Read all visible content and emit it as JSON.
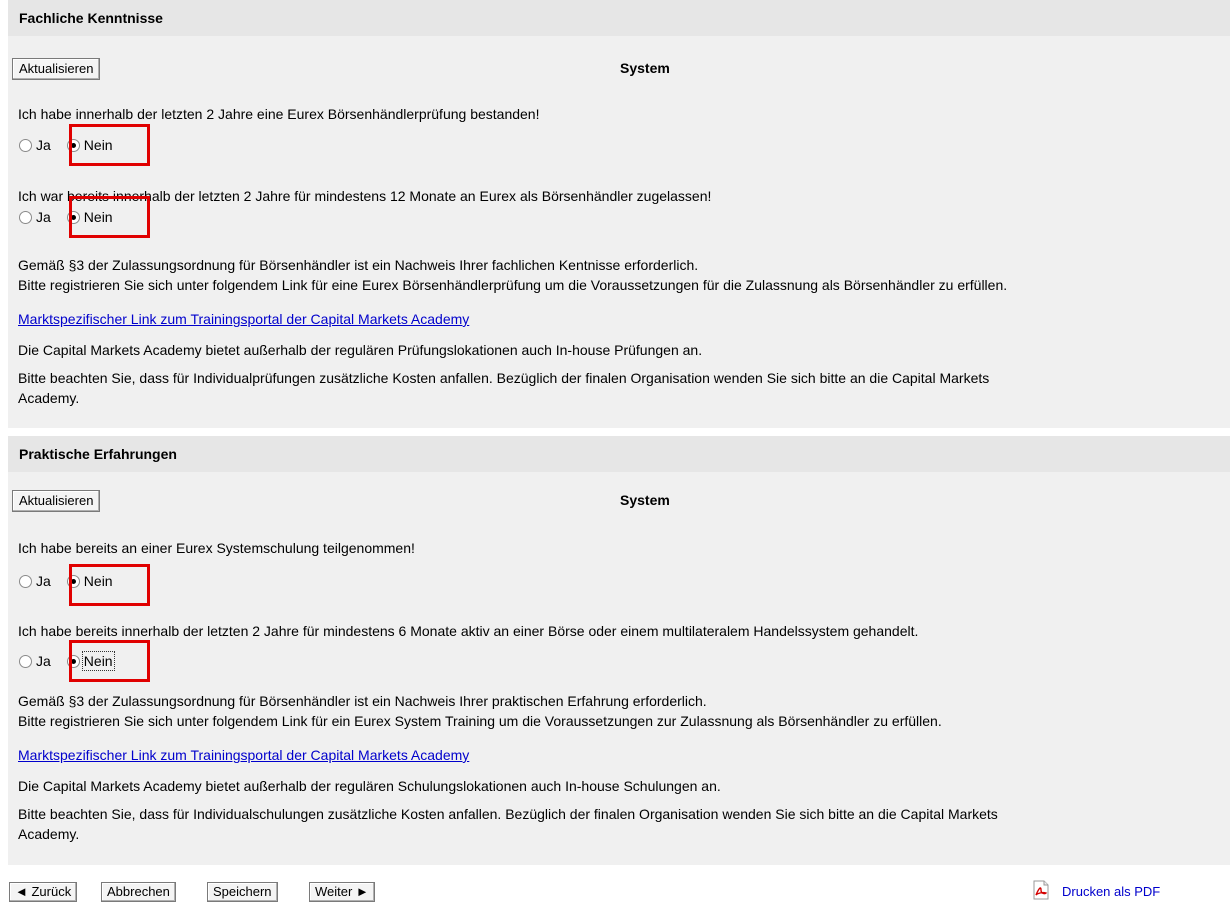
{
  "section1": {
    "title": "Fachliche Kenntnisse",
    "update_button": "Aktualisieren",
    "system_label": "System",
    "q1": {
      "text": "Ich habe innerhalb der letzten 2 Jahre eine Eurex Börsenhändlerprüfung bestanden!",
      "yes": "Ja",
      "no": "Nein",
      "selected": "Nein"
    },
    "q2": {
      "text": "Ich war bereits innerhalb der letzten 2 Jahre für mindestens 12 Monate an Eurex als Börsenhändler zugelassen!",
      "yes": "Ja",
      "no": "Nein",
      "selected": "Nein"
    },
    "info_line1": "Gemäß §3 der Zulassungsordnung für Börsenhändler ist ein Nachweis Ihrer fachlichen Kentnisse erforderlich.",
    "info_line2": "Bitte registrieren Sie sich unter folgendem Link für eine Eurex Börsenhändlerprüfung um die Voraussetzungen für die Zulassnung als Börsenhändler zu erfüllen.",
    "link": "Marktspezifischer Link zum Trainingsportal der Capital Markets Academy",
    "note1": "Die Capital Markets Academy bietet außerhalb der regulären Prüfungslokationen auch In-house Prüfungen an.",
    "note2_line1": "Bitte beachten Sie, dass für Individualprüfungen zusätzliche Kosten anfallen. Bezüglich der finalen Organisation wenden Sie sich bitte an die Capital Markets",
    "note2_line2": "Academy."
  },
  "section2": {
    "title": "Praktische Erfahrungen",
    "update_button": "Aktualisieren",
    "system_label": "System",
    "q1": {
      "text": "Ich habe bereits an einer Eurex Systemschulung teilgenommen!",
      "yes": "Ja",
      "no": "Nein",
      "selected": "Nein"
    },
    "q2": {
      "text": "Ich habe bereits innerhalb der letzten 2 Jahre für mindestens 6 Monate aktiv an einer Börse oder einem multilateralem Handelssystem gehandelt.",
      "yes": "Ja",
      "no": "Nein",
      "selected": "Nein"
    },
    "info_line1": "Gemäß §3 der Zulassungsordnung für Börsenhändler ist ein Nachweis Ihrer praktischen Erfahrung erforderlich.",
    "info_line2": "Bitte registrieren Sie sich unter folgendem Link für ein Eurex System Training um die Voraussetzungen zur Zulassnung als Börsenhändler zu erfüllen.",
    "link": "Marktspezifischer Link zum Trainingsportal der Capital Markets Academy",
    "note1": "Die Capital Markets Academy bietet außerhalb der regulären Schulungslokationen auch In-house Schulungen an.",
    "note2_line1": "Bitte beachten Sie, dass für Individualschulungen zusätzliche Kosten anfallen. Bezüglich der finalen Organisation wenden Sie sich bitte an die Capital Markets",
    "note2_line2": "Academy."
  },
  "footer": {
    "back": "◄ Zurück",
    "cancel": "Abbrechen",
    "save": "Speichern",
    "next": "Weiter ►",
    "pdf": "Drucken als PDF"
  },
  "colors": {
    "highlight": "#e00000",
    "link": "#0000cc",
    "panel": "#f0f0f0",
    "header": "#e6e6e6"
  }
}
